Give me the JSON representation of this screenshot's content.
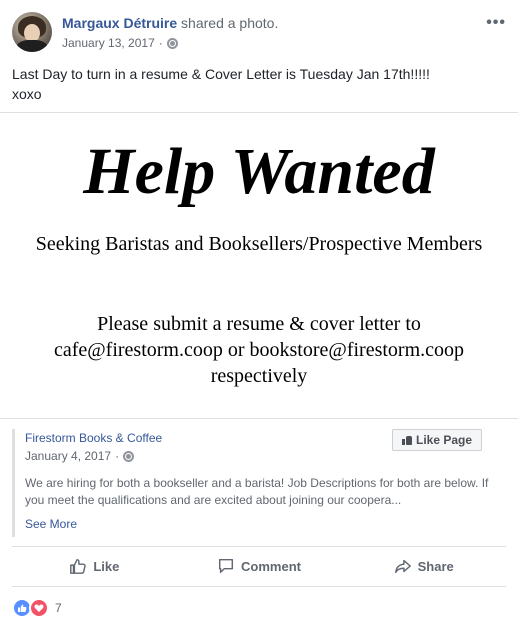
{
  "post": {
    "author": "Margaux Détruire",
    "action": " shared a photo.",
    "date": "January 13, 2017",
    "caption_line1": "Last Day to turn in a resume & Cover Letter is Tuesday Jan 17th!!!!!",
    "caption_line2": "xoxo"
  },
  "flyer": {
    "title": "Help Wanted",
    "subtitle": "Seeking Baristas and Booksellers/Prospective Members",
    "instructions": "Please submit a resume & cover letter to cafe@firestorm.coop or bookstore@firestorm.coop respectively"
  },
  "shared_page": {
    "name": "Firestorm Books & Coffee",
    "date": "January 4, 2017",
    "like_page_label": "Like Page",
    "description": "We are hiring for both a bookseller and a barista! Job Descriptions for both are below. If you meet the qualifications and are excited about joining our coopera...",
    "see_more": "See More"
  },
  "actions": {
    "like": "Like",
    "comment": "Comment",
    "share": "Share"
  },
  "reactions": {
    "count": "7",
    "types": [
      "like",
      "love"
    ]
  },
  "icons": [
    "more-options-icon",
    "globe-icon",
    "like-thumb-icon",
    "comment-bubble-icon",
    "share-arrow-icon",
    "love-heart-icon"
  ]
}
